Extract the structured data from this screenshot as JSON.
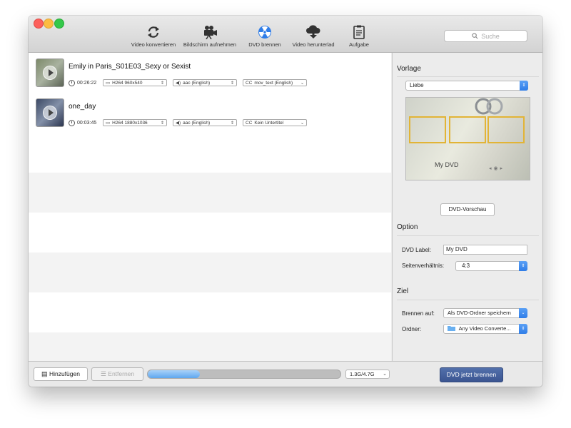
{
  "toolbar": {
    "items": [
      {
        "label": "Video konvertieren",
        "icon": "refresh-icon"
      },
      {
        "label": "Bildschirm aufnehmen",
        "icon": "video-camera-icon"
      },
      {
        "label": "DVD brennen",
        "icon": "dvd-burn-icon",
        "active": true
      },
      {
        "label": "Video herunterlad",
        "icon": "cloud-download-icon"
      },
      {
        "label": "Aufgabe",
        "icon": "clipboard-icon"
      }
    ],
    "search_placeholder": "Suche"
  },
  "files": [
    {
      "title": "Emily in Paris_S01E03_Sexy or Sexist",
      "duration": "00:26:22",
      "video": "H264 960x540",
      "audio": "aac (English)",
      "subtitle": "mov_text (English)"
    },
    {
      "title": "one_day",
      "duration": "00:03:45",
      "video": "H264 1880x1036",
      "audio": "aac (English)",
      "subtitle": "Kein Untertitel"
    }
  ],
  "labels": {
    "video_prefix": "▭",
    "cc_prefix": "CC"
  },
  "template": {
    "section": "Vorlage",
    "selected": "Liebe",
    "preview_text": "My DVD",
    "preview_button": "DVD-Vorschau"
  },
  "option": {
    "section": "Option",
    "dvd_label_label": "DVD Label:",
    "dvd_label_value": "My DVD",
    "aspect_label": "Seitenverhältnis:",
    "aspect_value": "4:3"
  },
  "target": {
    "section": "Ziel",
    "burn_to_label": "Brennen auf:",
    "burn_to_value": "Als DVD-Ordner speichern",
    "folder_label": "Ordner:",
    "folder_value": "Any Video Converte..."
  },
  "bottom": {
    "add_label": "Hinzufügen",
    "remove_label": "Entfernen",
    "progress_fraction": 0.27,
    "capacity": "1.3G/4.7G",
    "burn_label": "DVD jetzt brennen"
  },
  "colors": {
    "accent": "#2f7de8",
    "burn_button": "#3b5591",
    "progress_fill": "#5ea7ef"
  }
}
